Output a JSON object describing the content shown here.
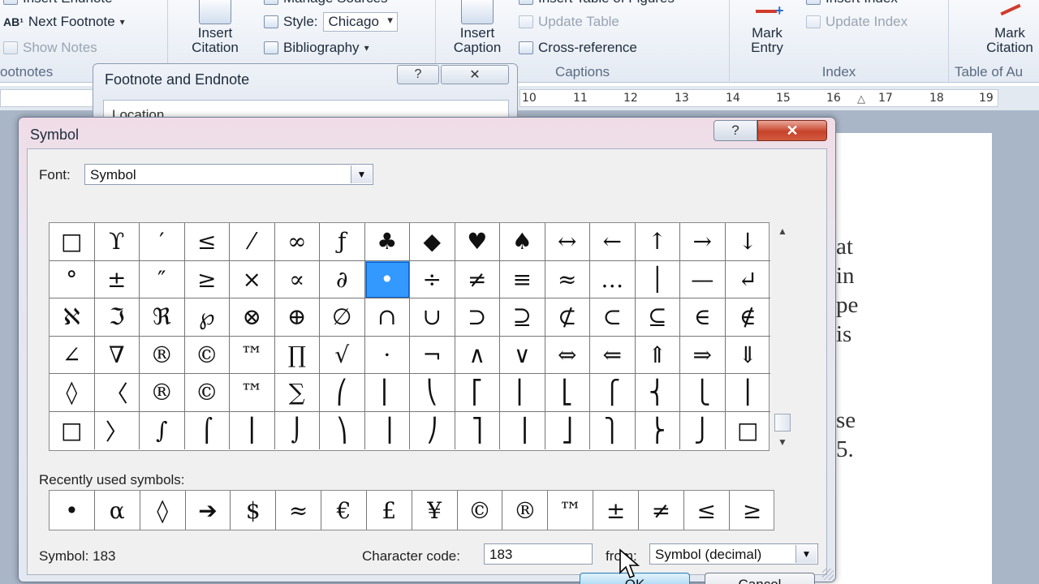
{
  "ribbon": {
    "footnotes": {
      "insert_endnote": "Insert Endnote",
      "next_footnote": "Next Footnote",
      "show_notes": "Show Notes",
      "group_label": "ootnotes"
    },
    "citations": {
      "insert_citation": "Insert\nCitation",
      "manage_sources": "Manage Sources",
      "style_label": "Style:",
      "style_value": "Chicago",
      "bibliography": "Bibliography"
    },
    "captions": {
      "insert_caption": "Insert\nCaption",
      "insert_table_of_figures": "Insert Table of Figures",
      "update_table": "Update Table",
      "cross_reference": "Cross-reference",
      "group_label": "Captions"
    },
    "index": {
      "mark_entry": "Mark\nEntry",
      "insert_index": "Insert Index",
      "update_index": "Update Index",
      "group_label": "Index"
    },
    "toa": {
      "mark_citation": "Mark\nCitation",
      "group_label": "Table of Au"
    }
  },
  "ruler": {
    "numbers": [
      "10",
      "11",
      "12",
      "13",
      "14",
      "15",
      "16",
      "17",
      "18",
      "19"
    ]
  },
  "document": {
    "line_fragments": [
      "at",
      "in",
      "pe",
      "is",
      "se",
      "5."
    ]
  },
  "footnote_dialog": {
    "title": "Footnote and Endnote",
    "help": "?",
    "close": "✕",
    "location_label": "Location"
  },
  "symbol_dialog": {
    "title": "Symbol",
    "help": "?",
    "close": "✕",
    "font_label": "Font:",
    "font_value": "Symbol",
    "symbols": [
      "□",
      "ϒ",
      "′",
      "≤",
      "⁄",
      "∞",
      "ƒ",
      "♣",
      "◆",
      "♥",
      "♠",
      "↔",
      "←",
      "↑",
      "→",
      "↓",
      "°",
      "±",
      "″",
      "≥",
      "×",
      "∝",
      "∂",
      "•",
      "÷",
      "≠",
      "≡",
      "≈",
      "…",
      "│",
      "—",
      "↵",
      "ℵ",
      "ℑ",
      "ℜ",
      "℘",
      "⊗",
      "⊕",
      "∅",
      "∩",
      "∪",
      "⊃",
      "⊇",
      "⊄",
      "⊂",
      "⊆",
      "∈",
      "∉",
      "∠",
      "∇",
      "®",
      "©",
      "™",
      "∏",
      "√",
      "⋅",
      "¬",
      "∧",
      "∨",
      "⇔",
      "⇐",
      "⇑",
      "⇒",
      "⇓",
      "◊",
      "〈",
      "®",
      "©",
      "™",
      "∑",
      "⎛",
      "⎜",
      "⎝",
      "⎡",
      "⎢",
      "⎣",
      "⎧",
      "⎨",
      "⎩",
      "⎪",
      "□",
      "〉",
      "∫",
      "⌠",
      "⎮",
      "⌡",
      "⎞",
      "⎟",
      "⎠",
      "⎤",
      "⎥",
      "⎦",
      "⎫",
      "⎬",
      "⎭",
      "□"
    ],
    "selected_index": 23,
    "recent_label": "Recently used symbols:",
    "recent": [
      "•",
      "α",
      "◊",
      "➔",
      "$",
      "≈",
      "€",
      "£",
      "¥",
      "©",
      "®",
      "™",
      "±",
      "≠",
      "≤",
      "≥"
    ],
    "symbol_info": "Symbol: 183",
    "char_code_label": "Character code:",
    "char_code_value": "183",
    "from_label": "from:",
    "from_value": "Symbol (decimal)",
    "ok_label": "OK",
    "cancel_label": "Cancel"
  },
  "colors": {
    "selected_cell": "#3399ff",
    "close_button": "#c7432b",
    "ok_button": "#b2dbf4"
  }
}
